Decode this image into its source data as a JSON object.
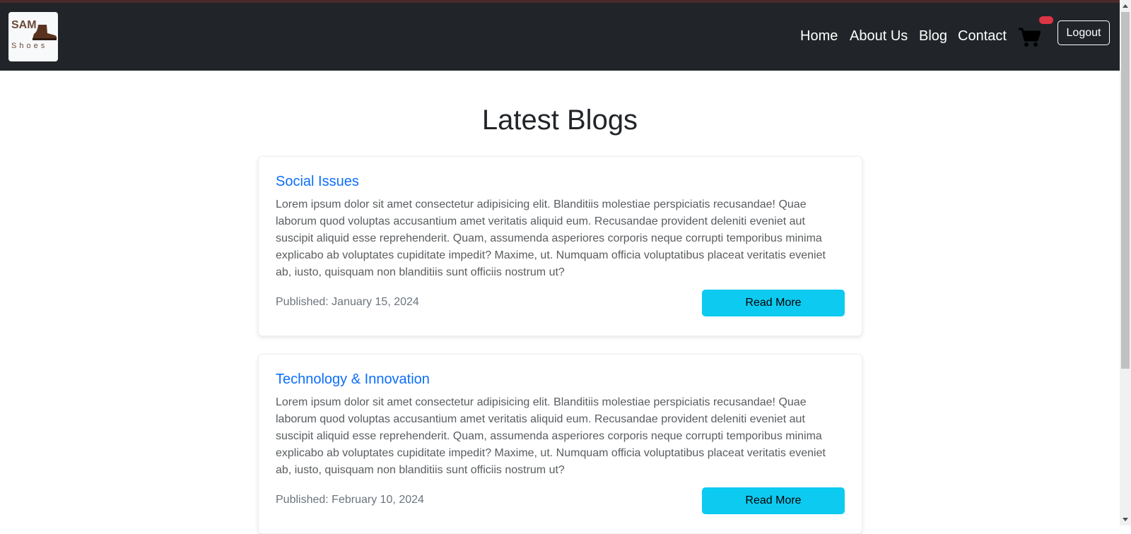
{
  "brand": {
    "logo_top": "SAM",
    "logo_bottom": "Shoes"
  },
  "nav": {
    "links": [
      "Home",
      "About Us",
      "Blog",
      "Contact"
    ],
    "logout_label": "Logout",
    "cart_icon": "shopping-cart-icon"
  },
  "page": {
    "title": "Latest Blogs"
  },
  "blogs": [
    {
      "title": "Social Issues",
      "text": "Lorem ipsum dolor sit amet consectetur adipisicing elit. Blanditiis molestiae perspiciatis recusandae! Quae laborum quod voluptas accusantium amet veritatis aliquid eum. Recusandae provident deleniti eveniet aut suscipit aliquid esse reprehenderit. Quam, assumenda asperiores corporis neque corrupti temporibus minima explicabo ab voluptates cupiditate impedit? Maxime, ut. Numquam officia voluptatibus placeat veritatis eveniet ab, iusto, quisquam non blanditiis sunt officiis nostrum ut?",
      "published": "Published: January 15, 2024",
      "button": "Read More"
    },
    {
      "title": "Technology & Innovation",
      "text": "Lorem ipsum dolor sit amet consectetur adipisicing elit. Blanditiis molestiae perspiciatis recusandae! Quae laborum quod voluptas accusantium amet veritatis aliquid eum. Recusandae provident deleniti eveniet aut suscipit aliquid esse reprehenderit. Quam, assumenda asperiores corporis neque corrupti temporibus minima explicabo ab voluptates cupiditate impedit? Maxime, ut. Numquam officia voluptatibus placeat veritatis eveniet ab, iusto, quisquam non blanditiis sunt officiis nostrum ut?",
      "published": "Published: February 10, 2024",
      "button": "Read More"
    }
  ],
  "colors": {
    "navbar": "#212529",
    "link": "#0d6efd",
    "button": "#0dcaf0",
    "badge": "#dc3545"
  }
}
